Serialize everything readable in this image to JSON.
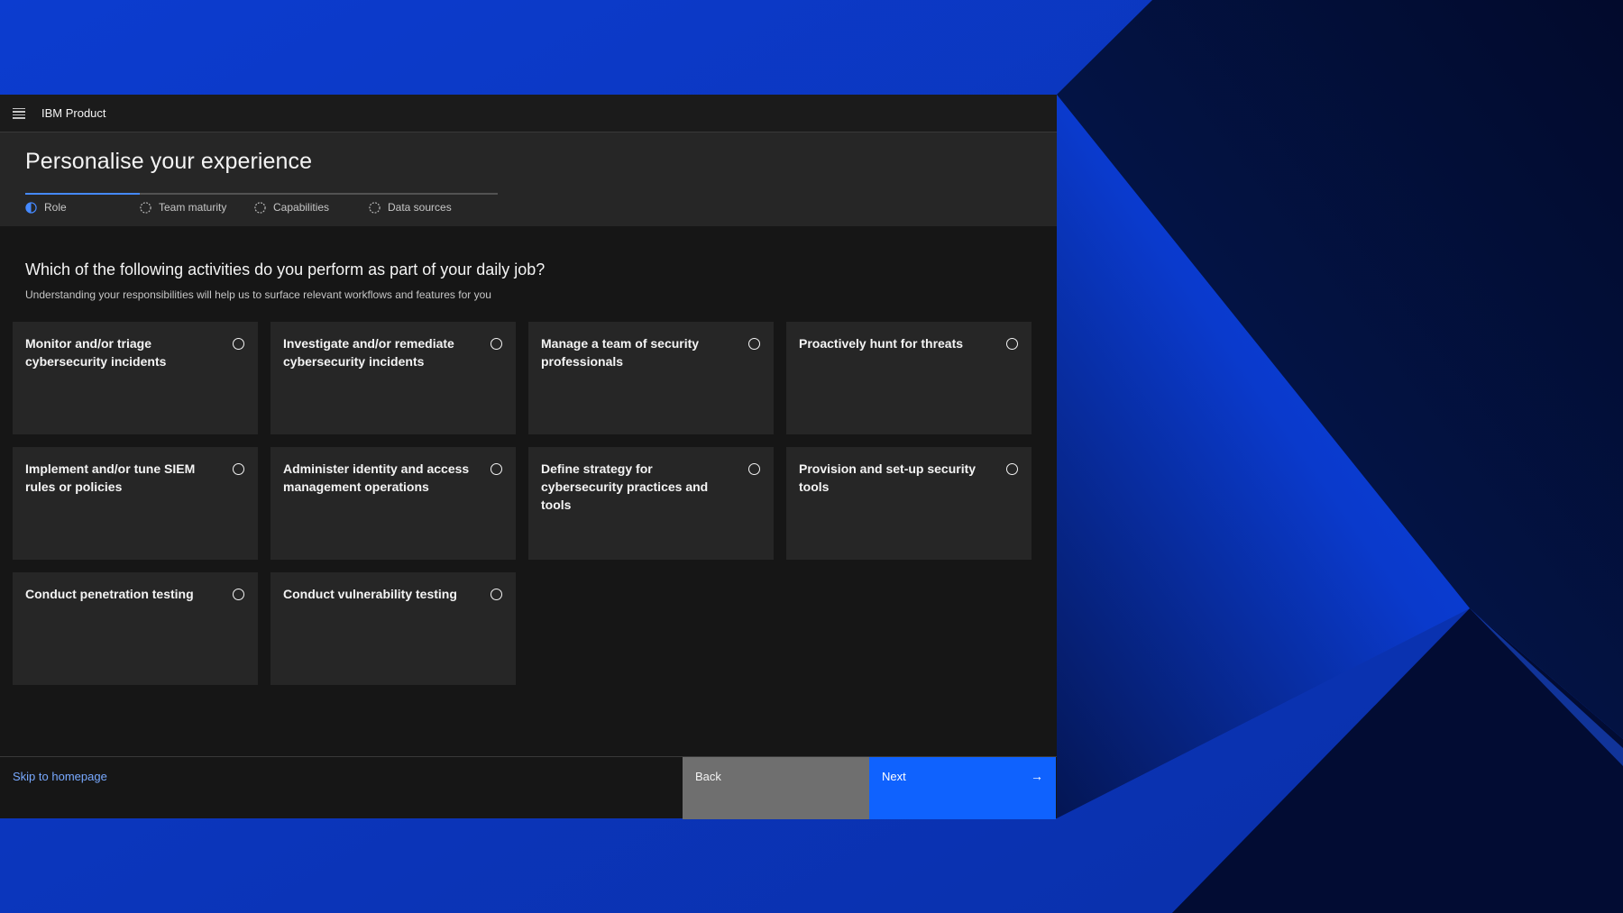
{
  "app": {
    "product_name": "IBM Product"
  },
  "header": {
    "title": "Personalise your experience",
    "steps": [
      {
        "label": "Role",
        "state": "current"
      },
      {
        "label": "Team maturity",
        "state": "incomplete"
      },
      {
        "label": "Capabilities",
        "state": "incomplete"
      },
      {
        "label": "Data sources",
        "state": "incomplete"
      }
    ]
  },
  "main": {
    "question": "Which of the following activities do you perform as part of your daily job?",
    "subtext": "Understanding your responsibilities will help us to surface relevant workflows and features for you",
    "options": [
      {
        "label": "Monitor and/or triage cybersecurity incidents",
        "selected": false
      },
      {
        "label": "Investigate and/or remediate cybersecurity incidents",
        "selected": false
      },
      {
        "label": "Manage a team of security professionals",
        "selected": false
      },
      {
        "label": "Proactively hunt for threats",
        "selected": false
      },
      {
        "label": "Implement and/or tune SIEM rules or policies",
        "selected": false
      },
      {
        "label": "Administer identity and access management operations",
        "selected": false
      },
      {
        "label": "Define strategy for cybersecurity practices and tools",
        "selected": false
      },
      {
        "label": "Provision and set-up security tools",
        "selected": false
      },
      {
        "label": "Conduct penetration testing",
        "selected": false
      },
      {
        "label": "Conduct vulnerability testing",
        "selected": false
      }
    ]
  },
  "footer": {
    "skip_label": "Skip to homepage",
    "back_label": "Back",
    "next_label": "Next",
    "next_icon": "arrow-right-icon"
  },
  "colors": {
    "accent": "#0f62fe",
    "link": "#78a9ff",
    "progress": "#4589ff",
    "background_blue": "#0a38c8"
  }
}
